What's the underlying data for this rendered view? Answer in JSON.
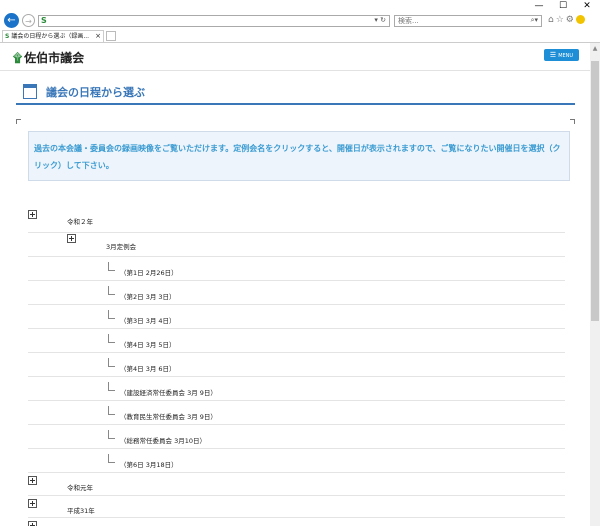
{
  "browser": {
    "window_controls": [
      "—",
      "☐",
      "✕"
    ],
    "search_placeholder": "検索...",
    "tab_title": "議会の日程から選ぶ（録画...",
    "tab_close": "×"
  },
  "site": {
    "logo_text": "佐伯市議会",
    "menu_label": "MENU"
  },
  "heading": "議会の日程から選ぶ",
  "notice": "過去の本会議・委員会の録画映像をご覧いただけます。定例会名をクリックすると、開催日が表示されますので、ご覧になりたい開催日を選択（クリック）して下さい。",
  "tree": {
    "year1": "令和２年",
    "session": "3月定例会",
    "days": [
      "（第1日 2月26日）",
      "（第2日 3月 3日）",
      "（第3日 3月 4日）",
      "（第4日 3月 5日）",
      "（第4日 3月 6日）",
      "（建設経済常任委員会 3月 9日）",
      "（教育民生常任委員会 3月 9日）",
      "（総務常任委員会 3月10日）",
      "（第6日 3月18日）"
    ],
    "year2": "令和元年",
    "year3": "平成31年"
  }
}
